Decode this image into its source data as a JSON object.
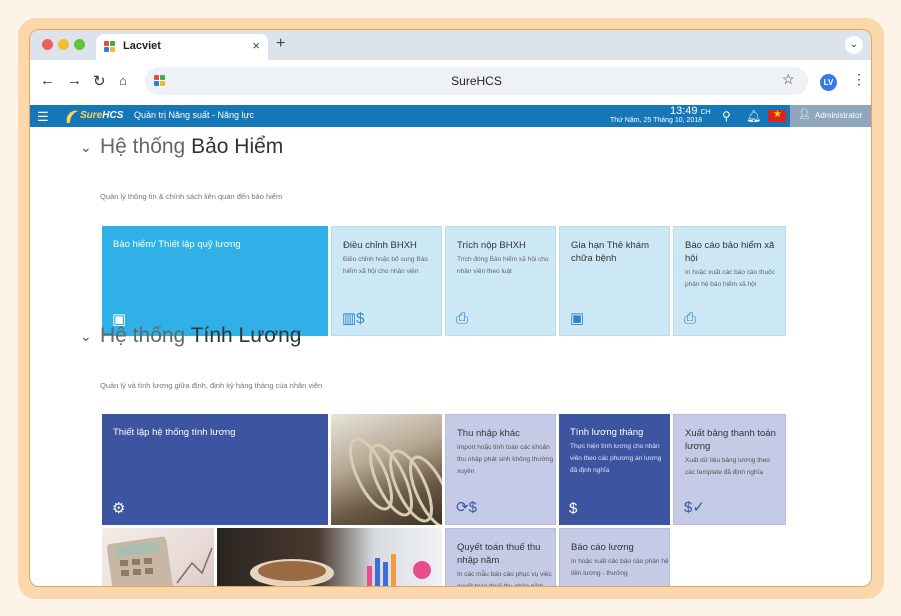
{
  "browser": {
    "tab_title": "Lacviet",
    "tab_close": "×",
    "new_tab": "+",
    "address": "SureHCS",
    "profile_initials": "LV"
  },
  "app": {
    "logo_text_1": "Sure",
    "logo_text_2": "HCS",
    "module": "Quản trị Năng suất - Năng lực",
    "time": "13:49",
    "time_suffix": "CH",
    "date": "Thứ Năm, 25 Tháng 10, 2018",
    "user": "Administrator"
  },
  "insurance": {
    "title_light": "Hệ thống",
    "title_bold": "Bảo Hiểm",
    "subtitle": "Quản lý thông tin & chính sách liên quan đến bảo hiểm",
    "tiles": [
      {
        "title": "Bảo hiểm/ Thiết lập quỹ lương",
        "desc": ""
      },
      {
        "title": "Điều chỉnh BHXH",
        "desc": "Điều chỉnh hoặc bổ sung Bảo hiểm xã hội cho nhân viên"
      },
      {
        "title": "Trích nộp BHXH",
        "desc": "Trích đóng Bảo hiểm xã hội cho nhân viên theo luật"
      },
      {
        "title": "Gia hạn Thẻ khám chữa bệnh",
        "desc": ""
      },
      {
        "title": "Báo cáo bảo hiểm xã hội",
        "desc": "In hoặc xuất các báo cáo thuộc phân hệ bảo hiểm xã hội"
      }
    ]
  },
  "payroll": {
    "title_light": "Hệ thống",
    "title_bold": "Tính Lương",
    "subtitle": "Quản lý và tính lương giữa định, định kỳ hàng tháng của nhân viên",
    "tiles": [
      {
        "title": "Thiết lập hệ thống tính lương",
        "desc": ""
      },
      {
        "title": "Thu nhập khác",
        "desc": "Import hoặc tính toán các khoản thu nhập phát sinh không thường xuyên"
      },
      {
        "title": "Tính lương tháng",
        "desc": "Thực hiện tính lương cho nhân viên theo các phương án lương đã định nghĩa"
      },
      {
        "title": "Xuất bảng thanh toán lương",
        "desc": "Xuất dữ liệu bảng lương theo các template đã định nghĩa"
      },
      {
        "title": "Quyết toán thuế thu nhập năm",
        "desc": "In các mẫu báo cáo phục vụ việc quyết toán thuế thu nhập năm"
      },
      {
        "title": "Báo cáo lương",
        "desc": "In hoặc xuất các báo cáo phân hệ tiền lương - thưởng"
      }
    ]
  },
  "colors": {
    "header_blue": "#1577b8",
    "tile_cyan": "#2fb0e6",
    "tile_light_blue": "#cde8f5",
    "tile_navy": "#3d55a1",
    "tile_lavender": "#c5cbe6"
  },
  "icons": [
    "back-arrow-icon",
    "forward-arrow-icon",
    "reload-icon",
    "home-icon",
    "star-icon",
    "menu-icon",
    "search-icon",
    "bell-icon",
    "user-icon",
    "money-icon",
    "gear-user-icon",
    "printer-icon"
  ]
}
